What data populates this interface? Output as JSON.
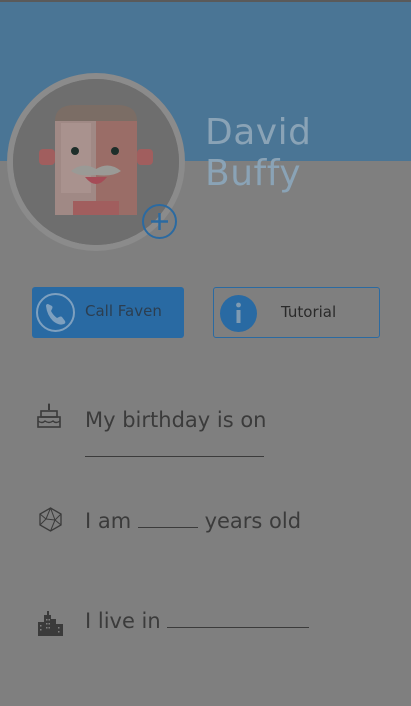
{
  "profile": {
    "name": "David Buffy"
  },
  "actions": {
    "call_label": "Call Faven",
    "tutorial_label": "Tutorial",
    "call_icon": "phone-icon",
    "tutorial_icon": "info-icon",
    "add_photo_icon": "plus-icon"
  },
  "facts": {
    "birthday_text": "My birthday is on",
    "age_prefix": "I am",
    "age_suffix": "years old",
    "live_text": "I live in",
    "birthday_icon": "cake-icon",
    "age_icon": "globe-icon",
    "live_icon": "city-icon"
  },
  "colors": {
    "header": "#4a7595",
    "accent": "#296aa3",
    "overlay": "#7f7f7f"
  }
}
